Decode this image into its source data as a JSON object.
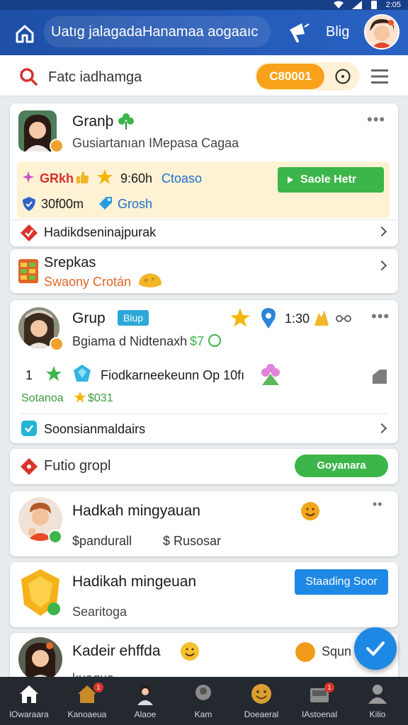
{
  "status": {
    "time": "2:​05"
  },
  "appbar": {
    "search_text": "Uatıg jalagadaHanamaa aogaaıc",
    "brand_label": "Blig"
  },
  "filterbar": {
    "placeholder": "Fatc iadhamga",
    "pill_label": "C80001"
  },
  "card1": {
    "title": "Granþ",
    "subtitle": "Gusiartanıan IMepasa Cagaa",
    "promo": {
      "line1_a": "GRkh",
      "line1_b": "9:60h",
      "line1_c": "Ctoaso",
      "line2_a": "30f00m",
      "line2_b": "Grosh",
      "button_label": "Saole Hetr"
    },
    "footer_text": "Hadikdseninajpurak"
  },
  "card2": {
    "title": "Srepkas",
    "subtitle": "Swaony Crotán"
  },
  "card3": {
    "title": "Grup",
    "tag": "Biup",
    "stat_value": "1:30",
    "subtitle_a": "Bgiama d Nidtenaxh",
    "subtitle_b": "$7",
    "row_number": "1",
    "row_text": "Fiodkarneekeunn Op 10fı",
    "status_text": "Sotanoa",
    "status_count": "$031",
    "footer_text": "Soonsianmaldairs"
  },
  "card4": {
    "label": "Futio gropl",
    "button_label": "Goyanara"
  },
  "card5": {
    "title": "Hadkah mingyauan",
    "meta_a": "$pandurall",
    "meta_b": "$ Rusosar"
  },
  "card6": {
    "title": "Hadikah mingeuan",
    "subtitle": "Searitoga",
    "button_label": "Staading Soor"
  },
  "card7": {
    "title": "Kadeir ehffda",
    "subtitle": "kuaqua",
    "right_label": "Squn"
  },
  "bottomnav": {
    "items": [
      {
        "label": "lOwaraara",
        "icon": "home-icon"
      },
      {
        "label": "Kanoaeua",
        "icon": "house-icon",
        "badge": "1"
      },
      {
        "label": "Alaoe",
        "icon": "person-icon"
      },
      {
        "label": "Kam",
        "icon": "profile-icon"
      },
      {
        "label": "Doeaeral",
        "icon": "emoji-icon"
      },
      {
        "label": "IAstoenal",
        "icon": "inbox-icon",
        "badge": "1"
      },
      {
        "label": "Kilio",
        "icon": "user-icon"
      }
    ]
  },
  "colors": {
    "appbar": "#1d4fa6",
    "accent_orange": "#f7a21a",
    "accent_green": "#3cb54a",
    "accent_blue": "#1e88e5",
    "nav_bg": "#24282f"
  }
}
